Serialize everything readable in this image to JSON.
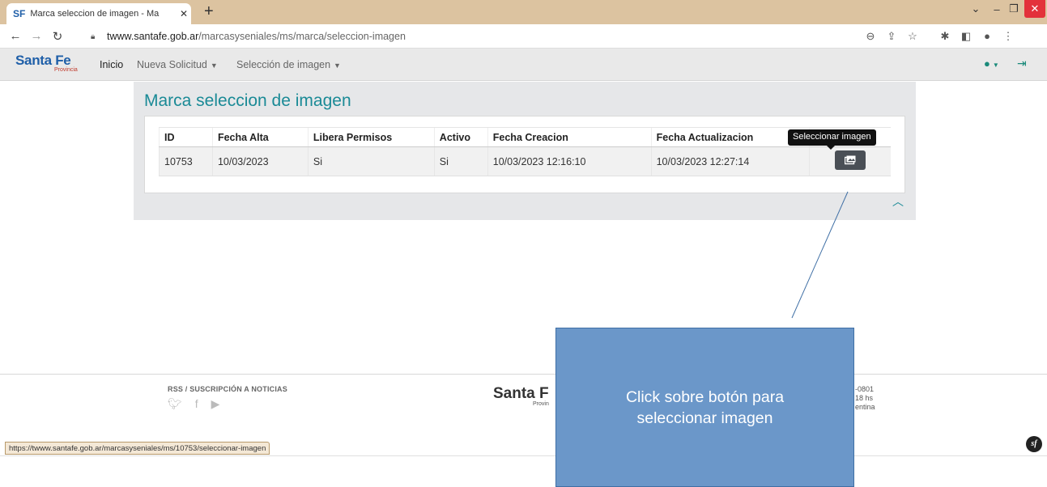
{
  "browser": {
    "tab_favicon": "SF",
    "tab_title": "Marca seleccion de imagen - Ma",
    "tab_close": "✕",
    "new_tab": "+",
    "url_host": "twww.santafe.gob.ar",
    "url_path": "/marcasyseniales/ms/marca/seleccion-imagen",
    "status_url": "https://twww.santafe.gob.ar/marcasyseniales/ms/10753/seleccionar-imagen"
  },
  "navbar": {
    "brand": "Santa Fe",
    "brand_sub": "Provincia",
    "items": [
      {
        "label": "Inicio"
      },
      {
        "label": "Nueva Solicitud"
      },
      {
        "label": "Selección de imagen"
      }
    ]
  },
  "page": {
    "title": "Marca seleccion de imagen",
    "table": {
      "headers": [
        "ID",
        "Fecha Alta",
        "Libera Permisos",
        "Activo",
        "Fecha Creacion",
        "Fecha Actualizacion",
        ""
      ],
      "rows": [
        [
          "10753",
          "10/03/2023",
          "Si",
          "Si",
          "10/03/2023 12:16:10",
          "10/03/2023 12:27:14"
        ]
      ]
    },
    "tooltip": "Seleccionar imagen"
  },
  "annotation": {
    "text": "Click sobre botón para seleccionar imagen",
    "color": "#6b97c9"
  },
  "footer": {
    "rss": "RSS / SUSCRIPCIÓN A NOTICIAS",
    "brand": "Santa F",
    "brand_sub": "Provin",
    "info": [
      "-0801",
      "18 hs",
      "entina"
    ]
  },
  "colors": {
    "accent": "#1a8a96",
    "brand": "#1f5fa8",
    "tabbar": "#dcc3a0"
  }
}
